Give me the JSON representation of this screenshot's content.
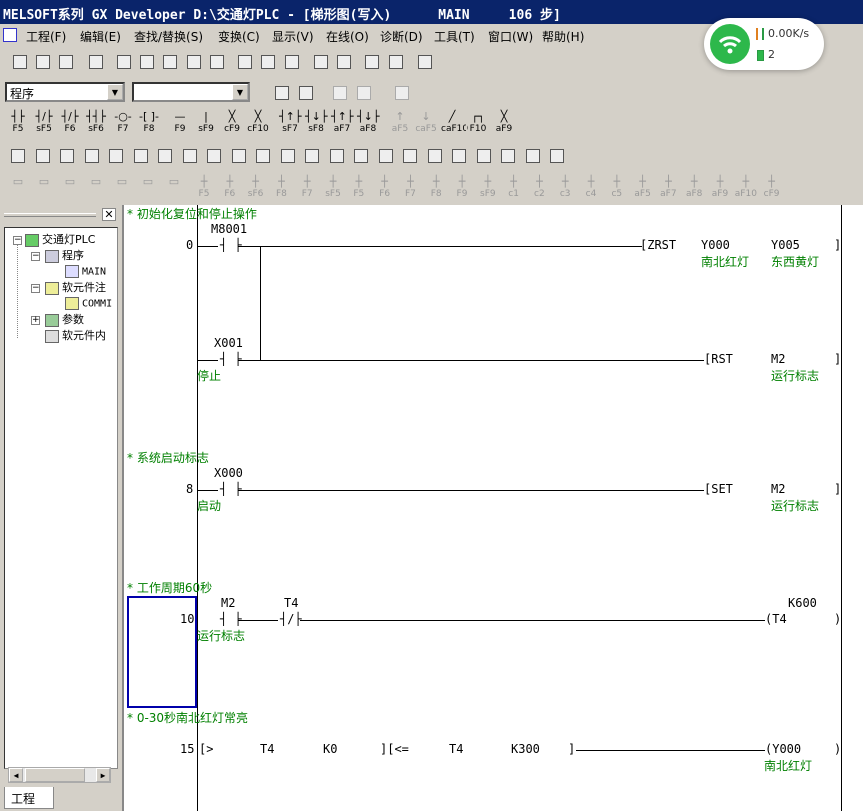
{
  "window": {
    "title": "MELSOFT系列 GX Developer D:\\交通灯PLC - [梯形图(写入)      MAIN     106 步]"
  },
  "menu": [
    "工程(F)",
    "编辑(E)",
    "查找/替换(S)",
    "变换(C)",
    "显示(V)",
    "在线(O)",
    "诊断(D)",
    "工具(T)",
    "窗口(W)",
    "帮助(H)"
  ],
  "combos": {
    "program_type": "程序",
    "device": ""
  },
  "fkeys": [
    {
      "g": "┤├",
      "k": "F5"
    },
    {
      "g": "┤/├",
      "k": "sF5"
    },
    {
      "g": "┤/├",
      "k": "F6"
    },
    {
      "g": "┤┤├",
      "k": "sF6"
    },
    {
      "g": "-○-",
      "k": "F7"
    },
    {
      "g": "-[ ]-",
      "k": "F8"
    },
    {
      "g": "—",
      "k": "F9"
    },
    {
      "g": "|",
      "k": "sF9"
    },
    {
      "g": "╳",
      "k": "cF9"
    },
    {
      "g": "╳",
      "k": "cF10"
    },
    {
      "g": "┤↑├",
      "k": "sF7"
    },
    {
      "g": "┤↓├",
      "k": "sF8"
    },
    {
      "g": "┤↑├",
      "k": "aF7"
    },
    {
      "g": "┤↓├",
      "k": "aF8"
    },
    {
      "g": "↑",
      "k": "aF5"
    },
    {
      "g": "↓",
      "k": "caF5"
    },
    {
      "g": "╱",
      "k": "caF10"
    },
    {
      "g": "┌┐",
      "k": "F10"
    },
    {
      "g": "╳",
      "k": "aF9"
    }
  ],
  "fkeys2": [
    "F5",
    "F6",
    "sF6",
    "F8",
    "F7",
    "sF5",
    "F5",
    "F6",
    "F7",
    "F8",
    "F9",
    "sF9",
    "c1",
    "c2",
    "c3",
    "c4",
    "c5",
    "aF5",
    "aF7",
    "aF8",
    "aF9",
    "aF10",
    "cF9"
  ],
  "tree": {
    "root": "交通灯PLC",
    "program": "程序",
    "main": "MAIN",
    "dev_comment": "软元件注",
    "comment": "COMMI",
    "param": "参数",
    "dev_mem": "软元件内"
  },
  "tab": "工程",
  "ladder": {
    "c1": "* 初始化复位和停止操作",
    "s0": "0",
    "m8001": "M8001",
    "zrst": "ZRST",
    "y000": "Y000",
    "y005": "Y005",
    "y000c": "南北红灯",
    "y005c": "东西黄灯",
    "x001": "X001",
    "x001c": "停止",
    "rst": "RST",
    "m2a": "M2",
    "m2ca": "运行标志",
    "c2": "* 系统启动标志",
    "s8": "8",
    "x000": "X000",
    "x000c": "启动",
    "set": "SET",
    "m2b": "M2",
    "m2cb": "运行标志",
    "c3": "* 工作周期60秒",
    "s10": "10",
    "m2c": "M2",
    "m2cc": "运行标志",
    "t4a": "T4",
    "k600": "K600",
    "t4coil": "T4",
    "c4": "* 0-30秒南北红灯常亮",
    "s15": "15",
    "gt": ">",
    "t4b": "T4",
    "k0": "K0",
    "le": "<=",
    "t4c": "T4",
    "k300": "K300",
    "y000b": "Y000",
    "y000bc": "南北红灯"
  },
  "net": {
    "speed": "0.00K/s",
    "count": "2"
  }
}
